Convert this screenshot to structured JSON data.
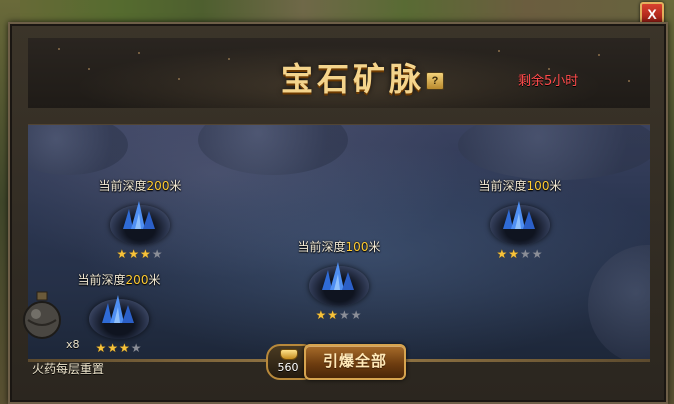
{
  "window": {
    "title": "宝石矿脉",
    "close_label": "X",
    "help_label": "?"
  },
  "time_remaining": "剩余5小时",
  "mines": [
    {
      "label_prefix": "当前深度",
      "depth": "200",
      "label_suffix": "米",
      "stars": "★★★",
      "stars_off": "★"
    },
    {
      "label_prefix": "当前深度",
      "depth": "100",
      "label_suffix": "米",
      "stars": "★★",
      "stars_off": "★★"
    },
    {
      "label_prefix": "当前深度",
      "depth": "100",
      "label_suffix": "米",
      "stars": "★★",
      "stars_off": "★★"
    },
    {
      "label_prefix": "当前深度",
      "depth": "200",
      "label_suffix": "米",
      "stars": "★★★",
      "stars_off": "★"
    }
  ],
  "gunpowder": {
    "count": "x8",
    "description": "火药每层重置"
  },
  "detonate": {
    "cost": "560",
    "label": "引爆全部"
  },
  "colors": {
    "accent_gold": "#f4d48c",
    "warning_red": "#ff4b4b",
    "depth_number": "#ffcc33",
    "star_on": "#f7c23a"
  },
  "icons": {
    "close": "close-icon",
    "help": "help-icon",
    "gunpowder": "bomb-icon",
    "gold": "gold-ingot-icon",
    "crystal": "blue-crystal-icon",
    "star": "star-icon"
  }
}
